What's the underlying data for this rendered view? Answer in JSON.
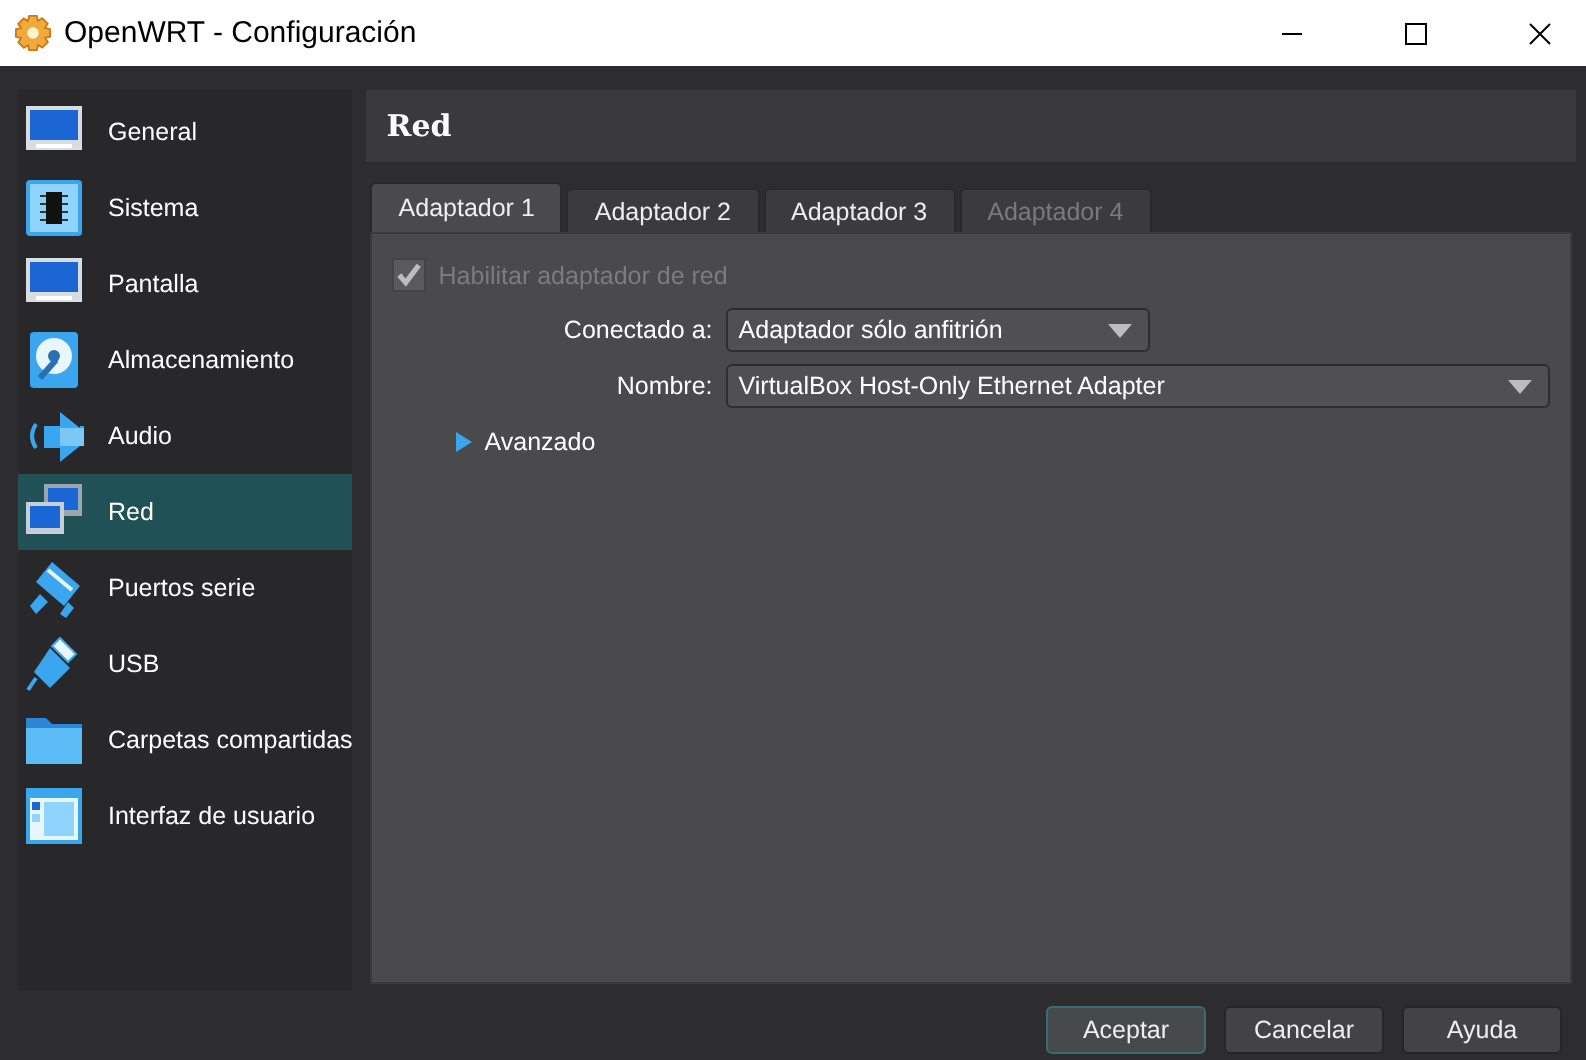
{
  "window": {
    "title": "OpenWRT - Configuración"
  },
  "sidebar": {
    "items": [
      {
        "label": "General",
        "kind": "monitor",
        "selected": false
      },
      {
        "label": "Sistema",
        "kind": "chip",
        "selected": false
      },
      {
        "label": "Pantalla",
        "kind": "monitor",
        "selected": false
      },
      {
        "label": "Almacenamiento",
        "kind": "disk",
        "selected": false
      },
      {
        "label": "Audio",
        "kind": "speaker",
        "selected": false
      },
      {
        "label": "Red",
        "kind": "network",
        "selected": true
      },
      {
        "label": "Puertos serie",
        "kind": "serial",
        "selected": false
      },
      {
        "label": "USB",
        "kind": "usb",
        "selected": false
      },
      {
        "label": "Carpetas compartidas",
        "kind": "folder",
        "selected": false
      },
      {
        "label": "Interfaz de usuario",
        "kind": "window",
        "selected": false
      }
    ]
  },
  "section_title": "Red",
  "tabs": [
    {
      "label": "Adaptador 1",
      "selected": true,
      "disabled": false
    },
    {
      "label": "Adaptador 2",
      "selected": false,
      "disabled": false
    },
    {
      "label": "Adaptador 3",
      "selected": false,
      "disabled": false
    },
    {
      "label": "Adaptador 4",
      "selected": false,
      "disabled": true
    }
  ],
  "enable_adapter": {
    "label": "Habilitar adaptador de red",
    "checked": true,
    "disabled": true
  },
  "fields": [
    {
      "label": "Conectado a:",
      "value": "Adaptador sólo anfitrión"
    },
    {
      "label": "Nombre:",
      "value": "VirtualBox Host-Only Ethernet Adapter"
    }
  ],
  "advanced": {
    "label": "Avanzado",
    "expanded": false
  },
  "buttons": [
    {
      "label": "Aceptar",
      "default": true
    },
    {
      "label": "Cancelar",
      "default": false
    },
    {
      "label": "Ayuda",
      "default": false
    }
  ]
}
